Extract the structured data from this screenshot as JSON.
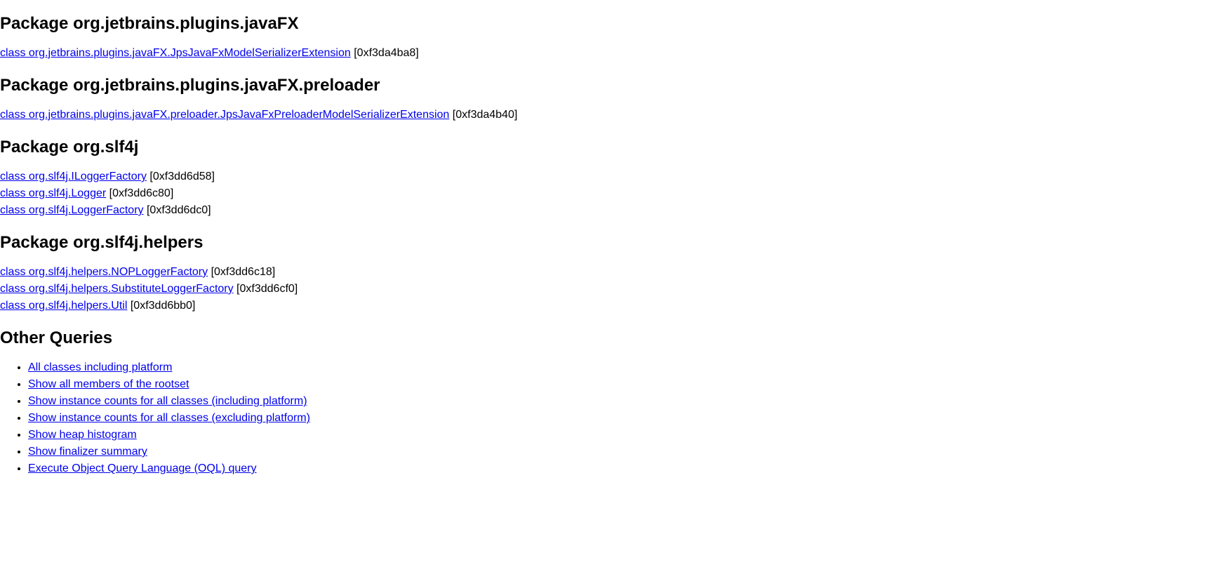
{
  "packages": [
    {
      "title": "Package org.jetbrains.plugins.javaFX",
      "classes": [
        {
          "link": "class org.jetbrains.plugins.javaFX.JpsJavaFxModelSerializerExtension",
          "address": "[0xf3da4ba8]"
        }
      ]
    },
    {
      "title": "Package org.jetbrains.plugins.javaFX.preloader",
      "classes": [
        {
          "link": "class org.jetbrains.plugins.javaFX.preloader.JpsJavaFxPreloaderModelSerializerExtension",
          "address": "[0xf3da4b40]"
        }
      ]
    },
    {
      "title": "Package org.slf4j",
      "classes": [
        {
          "link": "class org.slf4j.ILoggerFactory",
          "address": "[0xf3dd6d58]"
        },
        {
          "link": "class org.slf4j.Logger",
          "address": "[0xf3dd6c80]"
        },
        {
          "link": "class org.slf4j.LoggerFactory",
          "address": "[0xf3dd6dc0]"
        }
      ]
    },
    {
      "title": "Package org.slf4j.helpers",
      "classes": [
        {
          "link": "class org.slf4j.helpers.NOPLoggerFactory",
          "address": "[0xf3dd6c18]"
        },
        {
          "link": "class org.slf4j.helpers.SubstituteLoggerFactory",
          "address": "[0xf3dd6cf0]"
        },
        {
          "link": "class org.slf4j.helpers.Util",
          "address": "[0xf3dd6bb0]"
        }
      ]
    }
  ],
  "otherQueries": {
    "title": "Other Queries",
    "items": [
      "All classes including platform",
      "Show all members of the rootset",
      "Show instance counts for all classes (including platform)",
      "Show instance counts for all classes (excluding platform)",
      "Show heap histogram",
      "Show finalizer summary",
      "Execute Object Query Language (OQL) query"
    ]
  }
}
